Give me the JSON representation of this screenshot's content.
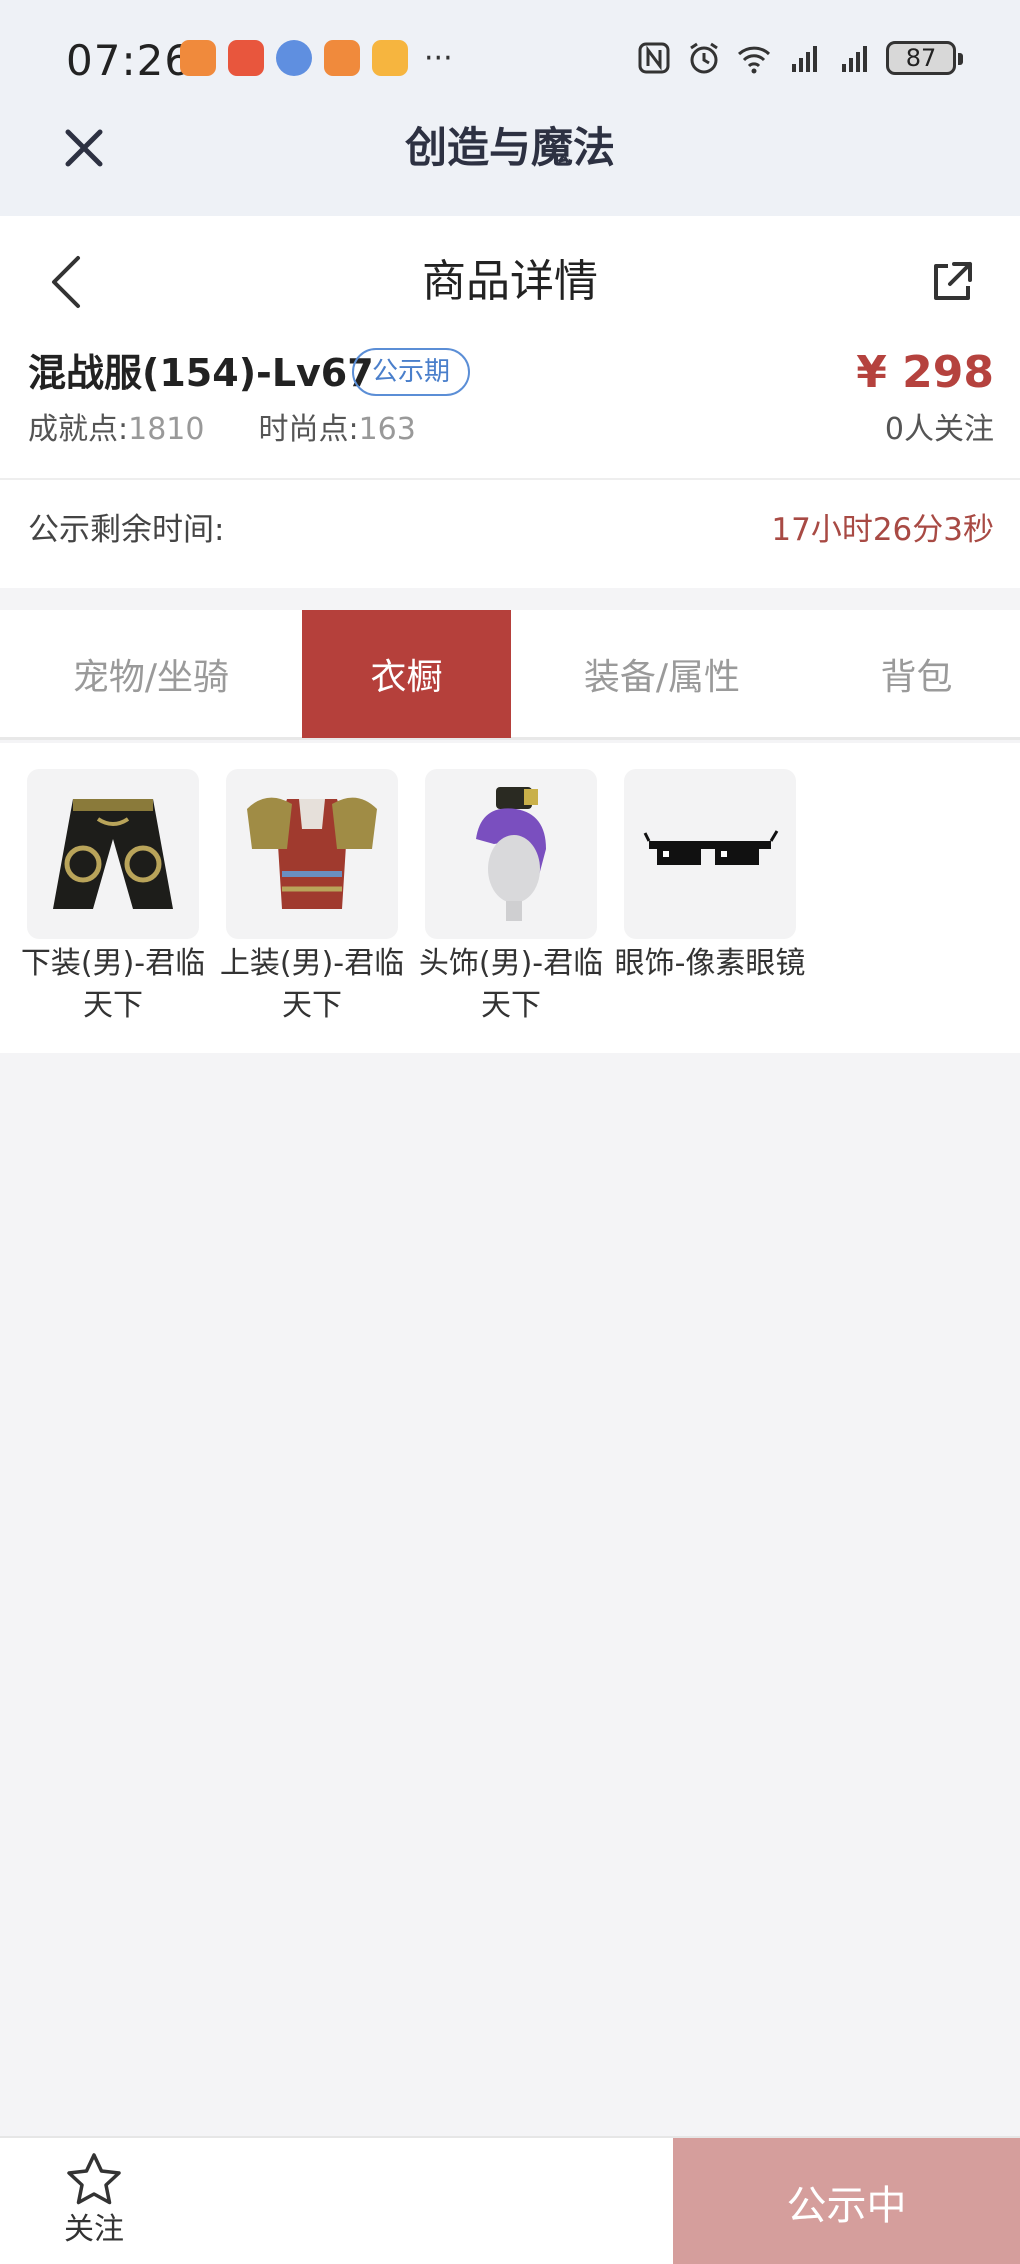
{
  "status_bar": {
    "time": "07:26",
    "more": "···",
    "battery": "87",
    "app_colors": [
      "#f08a3c",
      "#e8563d",
      "#5f8fe0",
      "#f08a3c",
      "#f6b53f"
    ]
  },
  "header": {
    "title": "创造与魔法"
  },
  "detail": {
    "page_title": "商品详情",
    "product_name": "混战服(154)-Lv67",
    "badge": "公示期",
    "price": "¥ 298",
    "achievement_label": "成就点:",
    "achievement_value": "1810",
    "fashion_label": "时尚点:",
    "fashion_value": "163",
    "follow_count": "0人关注",
    "remain_label": "公示剩余时间:",
    "remain_value": "17小时26分3秒"
  },
  "tabs": [
    {
      "label": "宠物/坐骑",
      "active": false
    },
    {
      "label": "衣橱",
      "active": true
    },
    {
      "label": "装备/属性",
      "active": false
    },
    {
      "label": "背包",
      "active": false
    }
  ],
  "wardrobe": [
    {
      "label": "下装(男)-君临天下",
      "icon": "pants-icon"
    },
    {
      "label": "上装(男)-君临天下",
      "icon": "armor-icon"
    },
    {
      "label": "头饰(男)-君临天下",
      "icon": "head-icon"
    },
    {
      "label": "眼饰-像素眼镜",
      "icon": "sunglasses-icon"
    }
  ],
  "bottom": {
    "follow_label": "关注",
    "status_button": "公示中"
  },
  "colors": {
    "accent": "#b5403b",
    "badge_blue": "#4a7fcb",
    "disabled_button": "#d59e9c"
  }
}
